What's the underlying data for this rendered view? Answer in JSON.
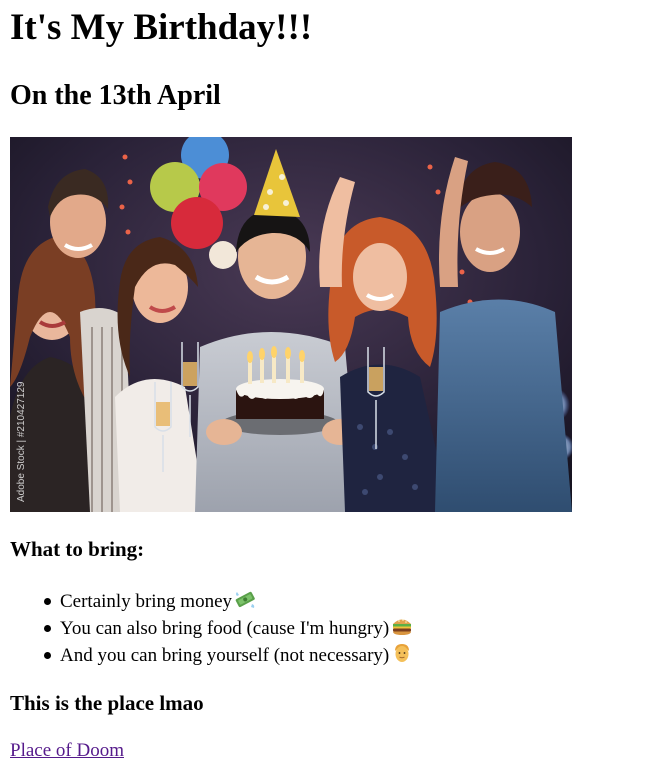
{
  "page": {
    "title": "It's My Birthday!!!",
    "subtitle": "On the 13th April"
  },
  "hero_image": {
    "watermark": "Adobe Stock | #210427129"
  },
  "bring_section": {
    "heading": "What to bring:",
    "items": [
      {
        "text": "Certainly bring money",
        "icon": "money-icon"
      },
      {
        "text": "You can also bring food (cause I'm hungry)",
        "icon": "burger-icon"
      },
      {
        "text": "And you can bring yourself (not necessary)",
        "icon": "person-icon"
      }
    ]
  },
  "place_section": {
    "heading": "This is the place lmao",
    "link_text": "Place of Doom"
  },
  "colors": {
    "link_visited": "#551a8b",
    "text": "#000000",
    "background": "#ffffff"
  }
}
